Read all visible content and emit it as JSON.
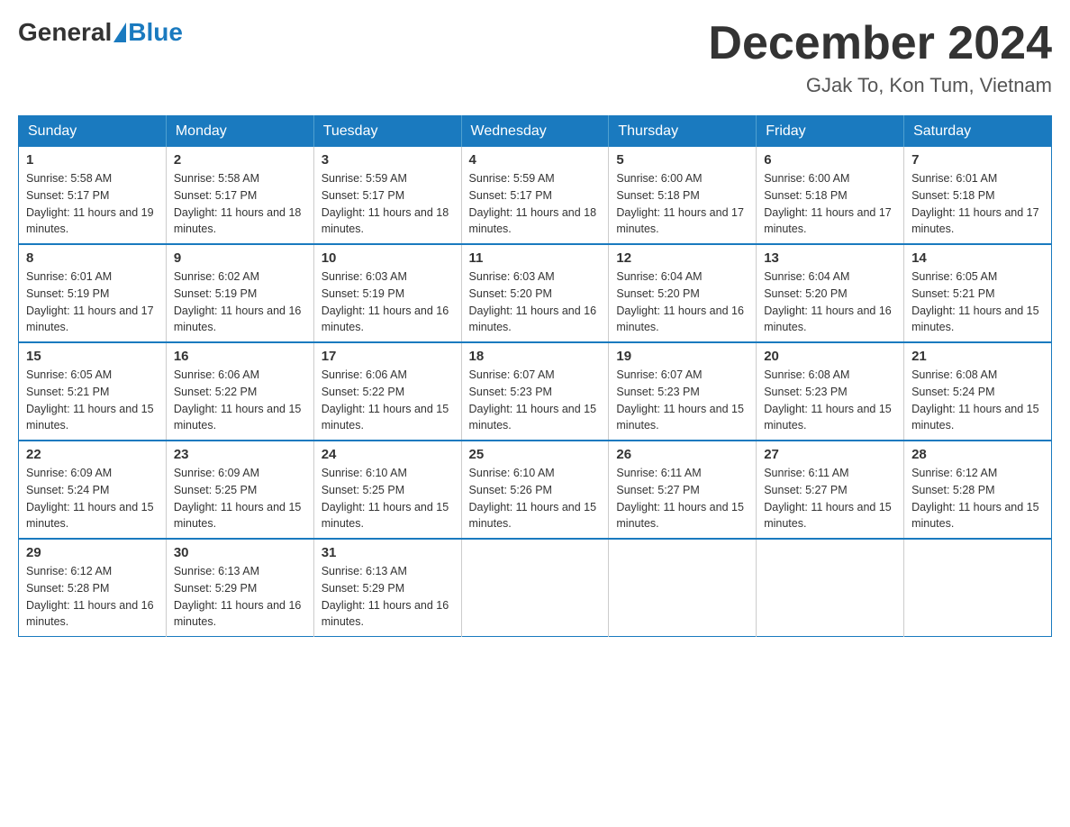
{
  "header": {
    "logo_general": "General",
    "logo_blue": "Blue",
    "month_title": "December 2024",
    "location": "GJak To, Kon Tum, Vietnam"
  },
  "weekdays": [
    "Sunday",
    "Monday",
    "Tuesday",
    "Wednesday",
    "Thursday",
    "Friday",
    "Saturday"
  ],
  "weeks": [
    [
      {
        "day": "1",
        "sunrise": "Sunrise: 5:58 AM",
        "sunset": "Sunset: 5:17 PM",
        "daylight": "Daylight: 11 hours and 19 minutes."
      },
      {
        "day": "2",
        "sunrise": "Sunrise: 5:58 AM",
        "sunset": "Sunset: 5:17 PM",
        "daylight": "Daylight: 11 hours and 18 minutes."
      },
      {
        "day": "3",
        "sunrise": "Sunrise: 5:59 AM",
        "sunset": "Sunset: 5:17 PM",
        "daylight": "Daylight: 11 hours and 18 minutes."
      },
      {
        "day": "4",
        "sunrise": "Sunrise: 5:59 AM",
        "sunset": "Sunset: 5:17 PM",
        "daylight": "Daylight: 11 hours and 18 minutes."
      },
      {
        "day": "5",
        "sunrise": "Sunrise: 6:00 AM",
        "sunset": "Sunset: 5:18 PM",
        "daylight": "Daylight: 11 hours and 17 minutes."
      },
      {
        "day": "6",
        "sunrise": "Sunrise: 6:00 AM",
        "sunset": "Sunset: 5:18 PM",
        "daylight": "Daylight: 11 hours and 17 minutes."
      },
      {
        "day": "7",
        "sunrise": "Sunrise: 6:01 AM",
        "sunset": "Sunset: 5:18 PM",
        "daylight": "Daylight: 11 hours and 17 minutes."
      }
    ],
    [
      {
        "day": "8",
        "sunrise": "Sunrise: 6:01 AM",
        "sunset": "Sunset: 5:19 PM",
        "daylight": "Daylight: 11 hours and 17 minutes."
      },
      {
        "day": "9",
        "sunrise": "Sunrise: 6:02 AM",
        "sunset": "Sunset: 5:19 PM",
        "daylight": "Daylight: 11 hours and 16 minutes."
      },
      {
        "day": "10",
        "sunrise": "Sunrise: 6:03 AM",
        "sunset": "Sunset: 5:19 PM",
        "daylight": "Daylight: 11 hours and 16 minutes."
      },
      {
        "day": "11",
        "sunrise": "Sunrise: 6:03 AM",
        "sunset": "Sunset: 5:20 PM",
        "daylight": "Daylight: 11 hours and 16 minutes."
      },
      {
        "day": "12",
        "sunrise": "Sunrise: 6:04 AM",
        "sunset": "Sunset: 5:20 PM",
        "daylight": "Daylight: 11 hours and 16 minutes."
      },
      {
        "day": "13",
        "sunrise": "Sunrise: 6:04 AM",
        "sunset": "Sunset: 5:20 PM",
        "daylight": "Daylight: 11 hours and 16 minutes."
      },
      {
        "day": "14",
        "sunrise": "Sunrise: 6:05 AM",
        "sunset": "Sunset: 5:21 PM",
        "daylight": "Daylight: 11 hours and 15 minutes."
      }
    ],
    [
      {
        "day": "15",
        "sunrise": "Sunrise: 6:05 AM",
        "sunset": "Sunset: 5:21 PM",
        "daylight": "Daylight: 11 hours and 15 minutes."
      },
      {
        "day": "16",
        "sunrise": "Sunrise: 6:06 AM",
        "sunset": "Sunset: 5:22 PM",
        "daylight": "Daylight: 11 hours and 15 minutes."
      },
      {
        "day": "17",
        "sunrise": "Sunrise: 6:06 AM",
        "sunset": "Sunset: 5:22 PM",
        "daylight": "Daylight: 11 hours and 15 minutes."
      },
      {
        "day": "18",
        "sunrise": "Sunrise: 6:07 AM",
        "sunset": "Sunset: 5:23 PM",
        "daylight": "Daylight: 11 hours and 15 minutes."
      },
      {
        "day": "19",
        "sunrise": "Sunrise: 6:07 AM",
        "sunset": "Sunset: 5:23 PM",
        "daylight": "Daylight: 11 hours and 15 minutes."
      },
      {
        "day": "20",
        "sunrise": "Sunrise: 6:08 AM",
        "sunset": "Sunset: 5:23 PM",
        "daylight": "Daylight: 11 hours and 15 minutes."
      },
      {
        "day": "21",
        "sunrise": "Sunrise: 6:08 AM",
        "sunset": "Sunset: 5:24 PM",
        "daylight": "Daylight: 11 hours and 15 minutes."
      }
    ],
    [
      {
        "day": "22",
        "sunrise": "Sunrise: 6:09 AM",
        "sunset": "Sunset: 5:24 PM",
        "daylight": "Daylight: 11 hours and 15 minutes."
      },
      {
        "day": "23",
        "sunrise": "Sunrise: 6:09 AM",
        "sunset": "Sunset: 5:25 PM",
        "daylight": "Daylight: 11 hours and 15 minutes."
      },
      {
        "day": "24",
        "sunrise": "Sunrise: 6:10 AM",
        "sunset": "Sunset: 5:25 PM",
        "daylight": "Daylight: 11 hours and 15 minutes."
      },
      {
        "day": "25",
        "sunrise": "Sunrise: 6:10 AM",
        "sunset": "Sunset: 5:26 PM",
        "daylight": "Daylight: 11 hours and 15 minutes."
      },
      {
        "day": "26",
        "sunrise": "Sunrise: 6:11 AM",
        "sunset": "Sunset: 5:27 PM",
        "daylight": "Daylight: 11 hours and 15 minutes."
      },
      {
        "day": "27",
        "sunrise": "Sunrise: 6:11 AM",
        "sunset": "Sunset: 5:27 PM",
        "daylight": "Daylight: 11 hours and 15 minutes."
      },
      {
        "day": "28",
        "sunrise": "Sunrise: 6:12 AM",
        "sunset": "Sunset: 5:28 PM",
        "daylight": "Daylight: 11 hours and 15 minutes."
      }
    ],
    [
      {
        "day": "29",
        "sunrise": "Sunrise: 6:12 AM",
        "sunset": "Sunset: 5:28 PM",
        "daylight": "Daylight: 11 hours and 16 minutes."
      },
      {
        "day": "30",
        "sunrise": "Sunrise: 6:13 AM",
        "sunset": "Sunset: 5:29 PM",
        "daylight": "Daylight: 11 hours and 16 minutes."
      },
      {
        "day": "31",
        "sunrise": "Sunrise: 6:13 AM",
        "sunset": "Sunset: 5:29 PM",
        "daylight": "Daylight: 11 hours and 16 minutes."
      },
      null,
      null,
      null,
      null
    ]
  ]
}
